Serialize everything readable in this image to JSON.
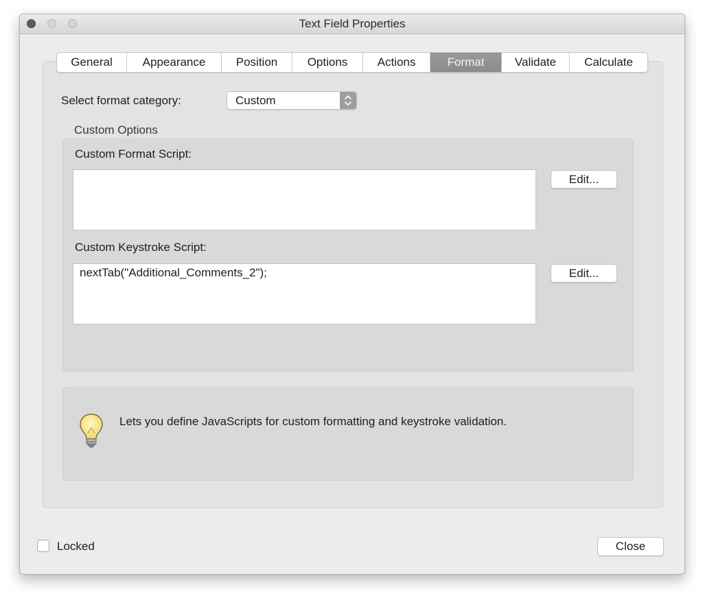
{
  "window": {
    "title": "Text Field Properties"
  },
  "tabs": [
    {
      "label": "General",
      "selected": false
    },
    {
      "label": "Appearance",
      "selected": false
    },
    {
      "label": "Position",
      "selected": false
    },
    {
      "label": "Options",
      "selected": false
    },
    {
      "label": "Actions",
      "selected": false
    },
    {
      "label": "Format",
      "selected": true
    },
    {
      "label": "Validate",
      "selected": false
    },
    {
      "label": "Calculate",
      "selected": false
    }
  ],
  "format": {
    "category_label": "Select format category:",
    "category_value": "Custom"
  },
  "custom_options": {
    "caption": "Custom Options",
    "format_script": {
      "label": "Custom Format Script:",
      "value": "",
      "edit_label": "Edit..."
    },
    "keystroke_script": {
      "label": "Custom Keystroke Script:",
      "value": "nextTab(\"Additional_Comments_2\");",
      "edit_label": "Edit..."
    }
  },
  "hint": {
    "icon": "lightbulb-icon",
    "text": "Lets you define JavaScripts for custom formatting and keystroke validation."
  },
  "footer": {
    "locked_label": "Locked",
    "locked_checked": false,
    "close_label": "Close"
  },
  "colors": {
    "window_bg": "#ececec",
    "panel_bg": "#e3e3e3",
    "group_bg": "#d9d9d9",
    "selected_tab": "#8f8f8f"
  }
}
